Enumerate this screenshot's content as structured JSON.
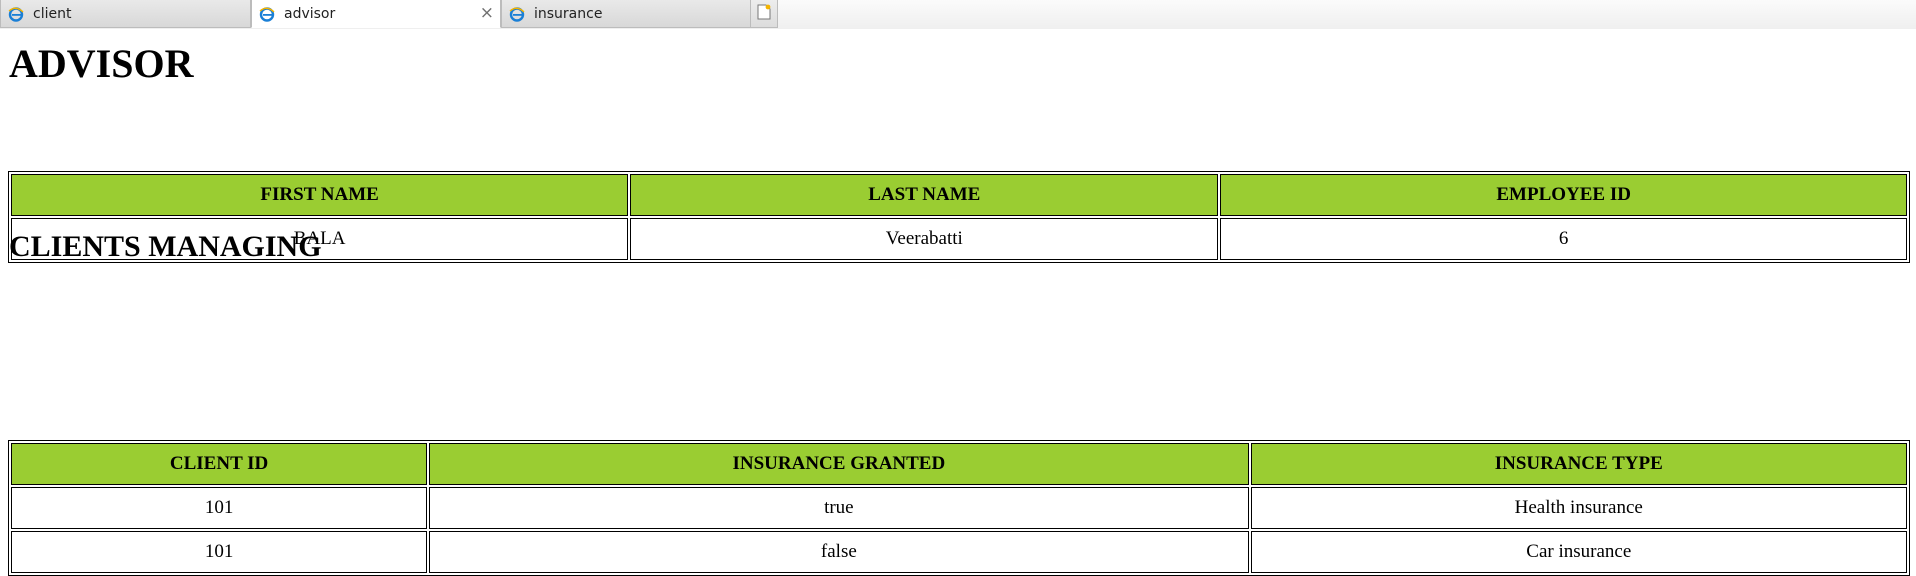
{
  "browser": {
    "tabs": [
      {
        "label": "client",
        "active": false,
        "icon": "ie-icon"
      },
      {
        "label": "advisor",
        "active": true,
        "icon": "ie-icon"
      },
      {
        "label": "insurance",
        "active": false,
        "icon": "ie-icon"
      }
    ],
    "close_glyph": "×"
  },
  "advisor": {
    "title": "ADVISOR",
    "headers": [
      "FIRST NAME",
      "LAST NAME",
      "EMPLOYEE ID"
    ],
    "row": [
      "BALA",
      "Veerabatti",
      "6"
    ]
  },
  "clients": {
    "title": "CLIENTS MANAGING",
    "headers": [
      "CLIENT ID",
      "INSURANCE GRANTED",
      "INSURANCE TYPE"
    ],
    "rows": [
      [
        "101",
        "true",
        "Health insurance"
      ],
      [
        "101",
        "false",
        "Car insurance"
      ]
    ]
  },
  "colors": {
    "header_bg": "#9acd32",
    "border": "#000000",
    "ie_blue": "#1a7fd6",
    "ie_ring": "#f4b400"
  }
}
